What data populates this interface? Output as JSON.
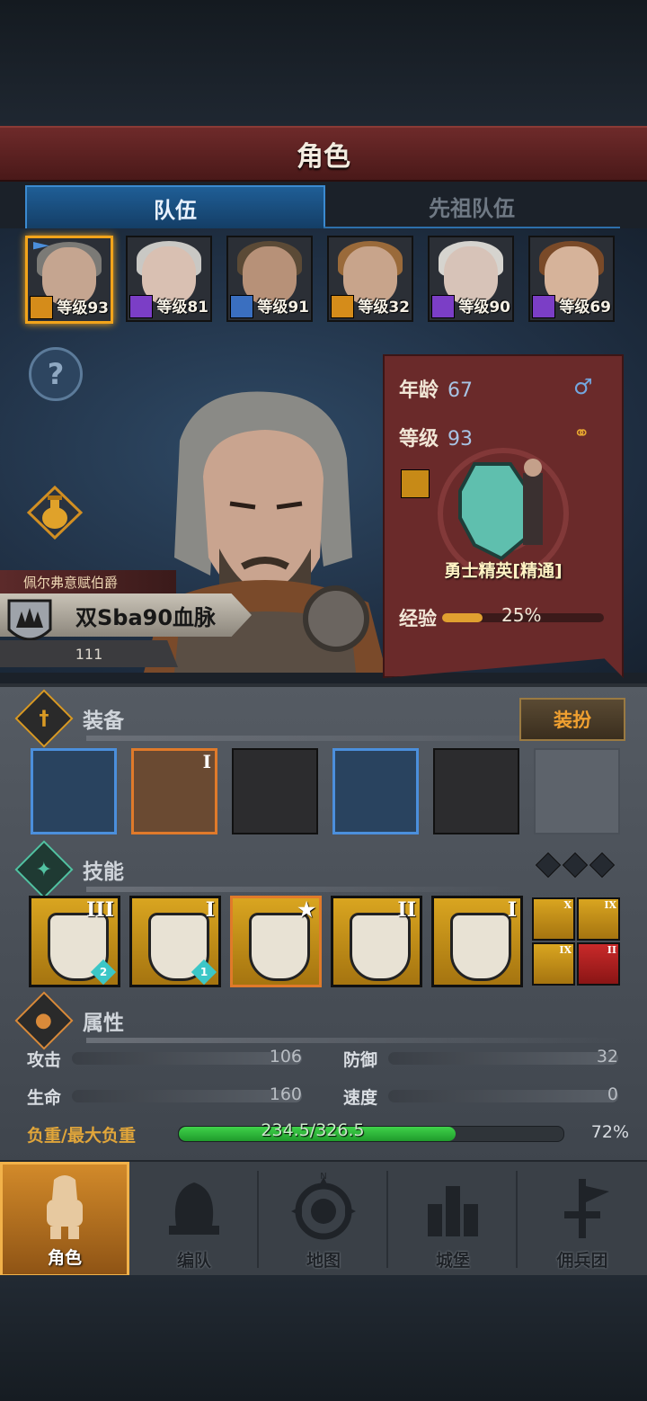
{
  "header": {
    "title": "角色"
  },
  "tabs": [
    {
      "label": "队伍"
    },
    {
      "label": "先祖队伍"
    }
  ],
  "roster": [
    {
      "level": "等级93",
      "badge_color": "#d58c1a",
      "hair": "#7b7a76",
      "skin": "#c5a590"
    },
    {
      "level": "等级81",
      "badge_color": "#7b3ec6",
      "hair": "#c9c8c4",
      "skin": "#d9c0b2"
    },
    {
      "level": "等级91",
      "badge_color": "#3a6fc0",
      "hair": "#5b4a36",
      "skin": "#b79178"
    },
    {
      "level": "等级32",
      "badge_color": "#d58c1a",
      "hair": "#9a6a3a",
      "skin": "#c8a48b"
    },
    {
      "level": "等级90",
      "badge_color": "#7b3ec6",
      "hair": "#d6d4cf",
      "skin": "#d7c3b8"
    },
    {
      "level": "等级69",
      "badge_color": "#7b3ec6",
      "hair": "#7a4a28",
      "skin": "#d6b39a"
    }
  ],
  "character": {
    "title": "佩尔弗意赋伯爵",
    "name": "双Sba90血脉",
    "sub_value": "111",
    "age_label": "年龄",
    "age": "67",
    "level_label": "等级",
    "level": "93",
    "class_name": "勇士精英[精通]",
    "exp_label": "经验",
    "exp_pct": "25%",
    "exp_fraction": 0.25
  },
  "equipment": {
    "label": "装备",
    "dress_button": "装扮",
    "slots": [
      {
        "name": "weapon-slot",
        "frame": "blue"
      },
      {
        "name": "shield-slot",
        "frame": "orange",
        "rank": "I"
      },
      {
        "name": "helmet-slot",
        "frame": "plain"
      },
      {
        "name": "armor-slot",
        "frame": "blue"
      },
      {
        "name": "boots-slot",
        "frame": "plain"
      },
      {
        "name": "ring-slot",
        "frame": "empty"
      }
    ]
  },
  "skills": {
    "label": "技能",
    "items": [
      {
        "rank": "III",
        "gem": "2"
      },
      {
        "rank": "I",
        "gem": "1"
      },
      {
        "rank": "★",
        "gem": ""
      },
      {
        "rank": "II",
        "gem": ""
      },
      {
        "rank": "I",
        "gem": ""
      }
    ],
    "passives": [
      {
        "rank": "X"
      },
      {
        "rank": "IX"
      },
      {
        "rank": "IX"
      },
      {
        "rank": "II"
      }
    ]
  },
  "attributes": {
    "label": "属性",
    "attack_label": "攻击",
    "attack": "106",
    "defense_label": "防御",
    "defense": "32",
    "hp_label": "生命",
    "hp": "160",
    "speed_label": "速度",
    "speed": "0",
    "load_label": "负重/最大负重",
    "load_text": "234.5/326.5",
    "load_pct": "72%",
    "load_fraction": 0.72
  },
  "nav": [
    {
      "label": "角色"
    },
    {
      "label": "编队"
    },
    {
      "label": "地图"
    },
    {
      "label": "城堡"
    },
    {
      "label": "佣兵团"
    }
  ],
  "colors": {
    "accent": "#f2a41b",
    "tab_blue": "#1f5e96",
    "banner_red": "#6a2a2a",
    "load_green": "#2fb43a"
  },
  "icons": {
    "help": "question-icon",
    "compass_letter": "N"
  }
}
